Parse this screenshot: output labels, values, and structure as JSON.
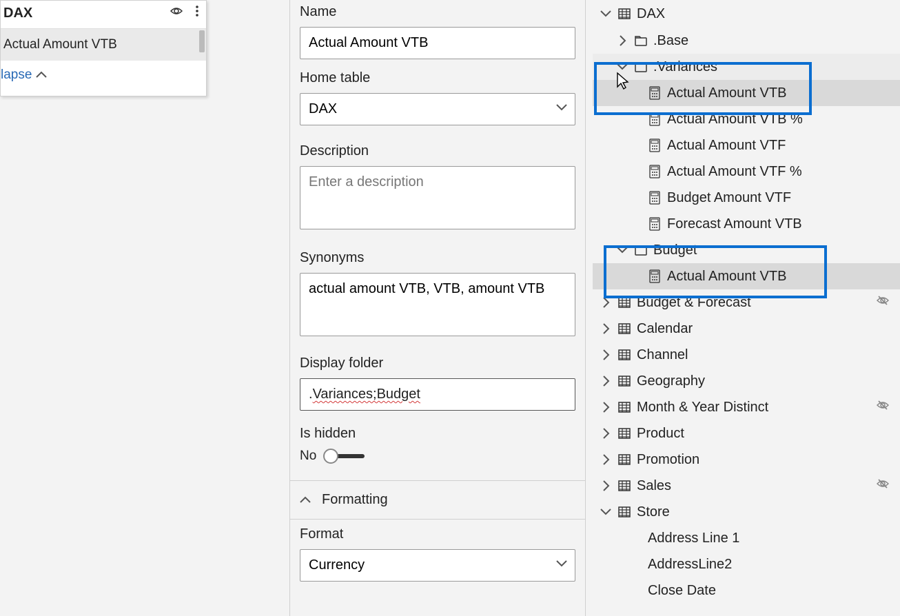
{
  "leftPanel": {
    "title": "DAX",
    "selectedItem": "Actual Amount VTB",
    "collapseLabel": "lapse"
  },
  "properties": {
    "nameLabel": "Name",
    "nameValue": "Actual Amount VTB",
    "homeTableLabel": "Home table",
    "homeTableValue": "DAX",
    "descriptionLabel": "Description",
    "descriptionPlaceholder": "Enter a description",
    "descriptionValue": "",
    "synonymsLabel": "Synonyms",
    "synonymsValue": "actual amount VTB, VTB, amount VTB",
    "displayFolderLabel": "Display folder",
    "displayFolderValue": ".Variances;Budget",
    "isHiddenLabel": "Is hidden",
    "isHiddenValue": "No",
    "formattingSection": "Formatting",
    "formatLabel": "Format",
    "formatValue": "Currency"
  },
  "fieldsTree": {
    "rootTable": "DAX",
    "baseFolder": ".Base",
    "variancesFolder": ".Variances",
    "variancesItems": [
      "Actual Amount VTB",
      "Actual Amount VTB %",
      "Actual Amount VTF",
      "Actual Amount VTF %",
      "Budget Amount VTF",
      "Forecast Amount VTB"
    ],
    "budgetFolder": "Budget",
    "budgetItems": [
      "Actual Amount VTB"
    ],
    "otherTables": [
      {
        "name": "Budget & Forecast",
        "hidden": true
      },
      {
        "name": "Calendar",
        "hidden": false
      },
      {
        "name": "Channel",
        "hidden": false
      },
      {
        "name": "Geography",
        "hidden": false
      },
      {
        "name": "Month & Year Distinct",
        "hidden": true
      },
      {
        "name": "Product",
        "hidden": false
      },
      {
        "name": "Promotion",
        "hidden": false
      },
      {
        "name": "Sales",
        "hidden": true
      }
    ],
    "storeTable": "Store",
    "storeColumns": [
      "Address Line 1",
      "AddressLine2",
      "Close Date"
    ]
  }
}
